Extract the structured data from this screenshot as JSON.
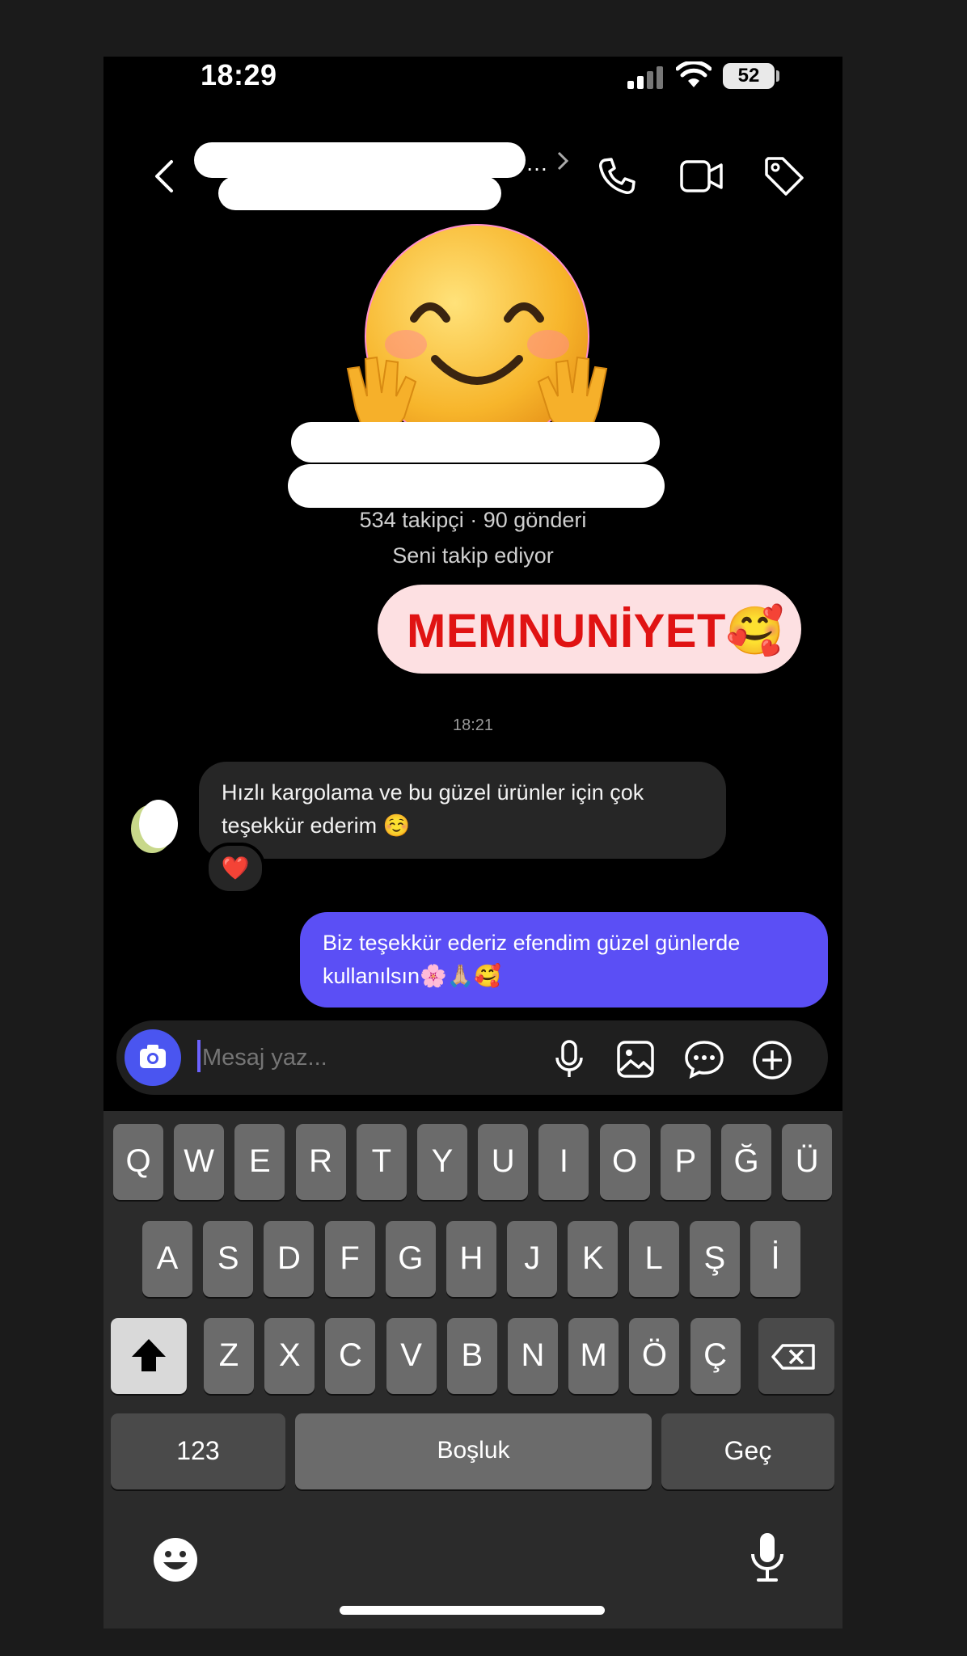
{
  "status_bar": {
    "time": "18:29",
    "battery": "52"
  },
  "profile": {
    "followers_posts": "534 takipçi · 90 gönderi",
    "follows_you": "Seni takip ediyor"
  },
  "messages": {
    "sticker_text": "MEMNUNİYET🥰",
    "timestamp": "18:21",
    "incoming": "Hızlı kargolama ve bu güzel ürünler için çok teşekkür ederim ☺️",
    "reaction": "❤️",
    "outgoing": "Biz teşekkür ederiz efendim güzel günlerde kullanılsın🌸🙏🏼🥰"
  },
  "composer": {
    "placeholder": "Mesaj yaz..."
  },
  "keyboard": {
    "row1": [
      "Q",
      "W",
      "E",
      "R",
      "T",
      "Y",
      "U",
      "I",
      "O",
      "P",
      "Ğ",
      "Ü"
    ],
    "row2": [
      "A",
      "S",
      "D",
      "F",
      "G",
      "H",
      "J",
      "K",
      "L",
      "Ş",
      "İ"
    ],
    "row3": [
      "Z",
      "X",
      "C",
      "V",
      "B",
      "N",
      "M",
      "Ö",
      "Ç"
    ],
    "numbers": "123",
    "space": "Boşluk",
    "go": "Geç"
  }
}
